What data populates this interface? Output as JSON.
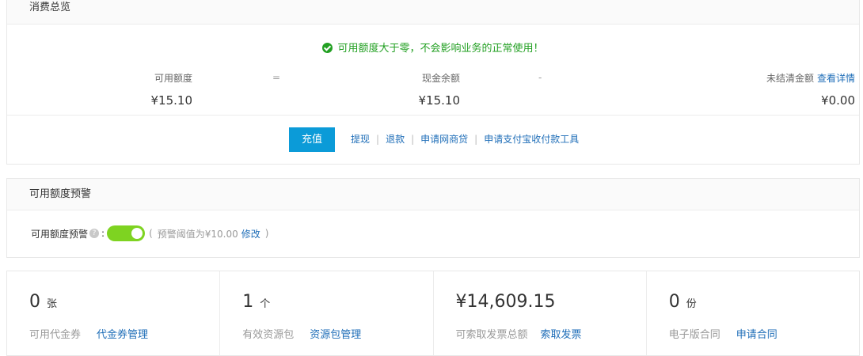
{
  "overview": {
    "title": "消费总览",
    "notice": "可用额度大于零，不会影响业务的正常使用！",
    "available": {
      "label": "可用额度",
      "value": "¥15.10"
    },
    "op_equals": "=",
    "cash": {
      "label": "现金余额",
      "value": "¥15.10"
    },
    "op_minus": "-",
    "unsettled": {
      "label": "未结清金额",
      "link": "查看详情",
      "value": "¥0.00"
    },
    "recharge_label": "充值",
    "links": [
      "提现",
      "退款",
      "申请网商贷",
      "申请支付宝收付款工具"
    ],
    "link_sep": "|"
  },
  "alert": {
    "title": "可用额度预警",
    "label": "可用额度预警",
    "help": "?",
    "colon": ":",
    "toggle_on": true,
    "paren_open": "(",
    "threshold_text": "预警阈值为¥10.00",
    "modify": "修改",
    "paren_close": ")"
  },
  "stats": [
    {
      "num": "0",
      "unit": "张",
      "label": "可用代金券",
      "link": "代金券管理"
    },
    {
      "num": "1",
      "unit": "个",
      "label": "有效资源包",
      "link": "资源包管理"
    },
    {
      "num": "¥14,609.15",
      "unit": "",
      "label": "可索取发票总额",
      "link": "索取发票"
    },
    {
      "num": "0",
      "unit": "份",
      "label": "电子版合同",
      "link": "申请合同"
    }
  ],
  "colors": {
    "accent": "#0b9bd8",
    "link": "#1f6eb8",
    "success": "#23a023",
    "toggle": "#7ed321"
  }
}
